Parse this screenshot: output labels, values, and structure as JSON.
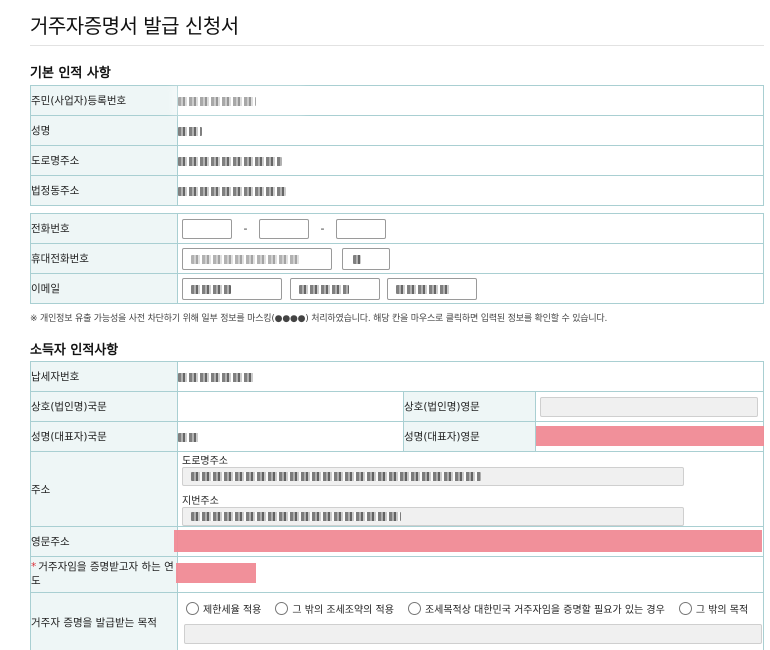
{
  "page_title": "거주자증명서 발급 신청서",
  "basic": {
    "section_title": "기본 인적 사항",
    "rows": {
      "rrn": "주민(사업자)등록번호",
      "name": "성명",
      "road_address": "도로명주소",
      "lot_address": "법정동주소"
    },
    "contact": {
      "phone": "전화번호",
      "mobile": "휴대전화번호",
      "email": "이메일"
    },
    "dash": "-"
  },
  "notice": "※ 개인정보 유출 가능성을 사전 차단하기 위해 일부 정보를 마스킹(●●●●) 처리하였습니다. 해당 칸을 마우스로 클릭하면 입력된 정보를 확인할 수 있습니다.",
  "income": {
    "section_title": "소득자 인적사항",
    "rows": {
      "tin": "납세자번호",
      "company_kr": "상호(법인명)국문",
      "company_en": "상호(법인명)영문",
      "rep_kr": "성명(대표자)국문",
      "rep_en": "성명(대표자)영문",
      "address": "주소",
      "road_address": "도로명주소",
      "lot_address": "지번주소",
      "address_en": "영문주소",
      "required_mark": "*",
      "year": "거주자임을 증명받고자 하는 연도",
      "purpose": "거주자 증명을 발급받는 목적"
    },
    "purpose_options": [
      "제한세율 적용",
      "그 밖의 조세조약의 적용",
      "조세목적상 대한민국 거주자임을 증명할 필요가 있는 경우",
      "그 밖의 목적"
    ]
  },
  "colors": {
    "header_bg": "#eef6f6",
    "border": "#a9cfd2",
    "redaction": "#f08a95",
    "required": "#d9323a"
  }
}
